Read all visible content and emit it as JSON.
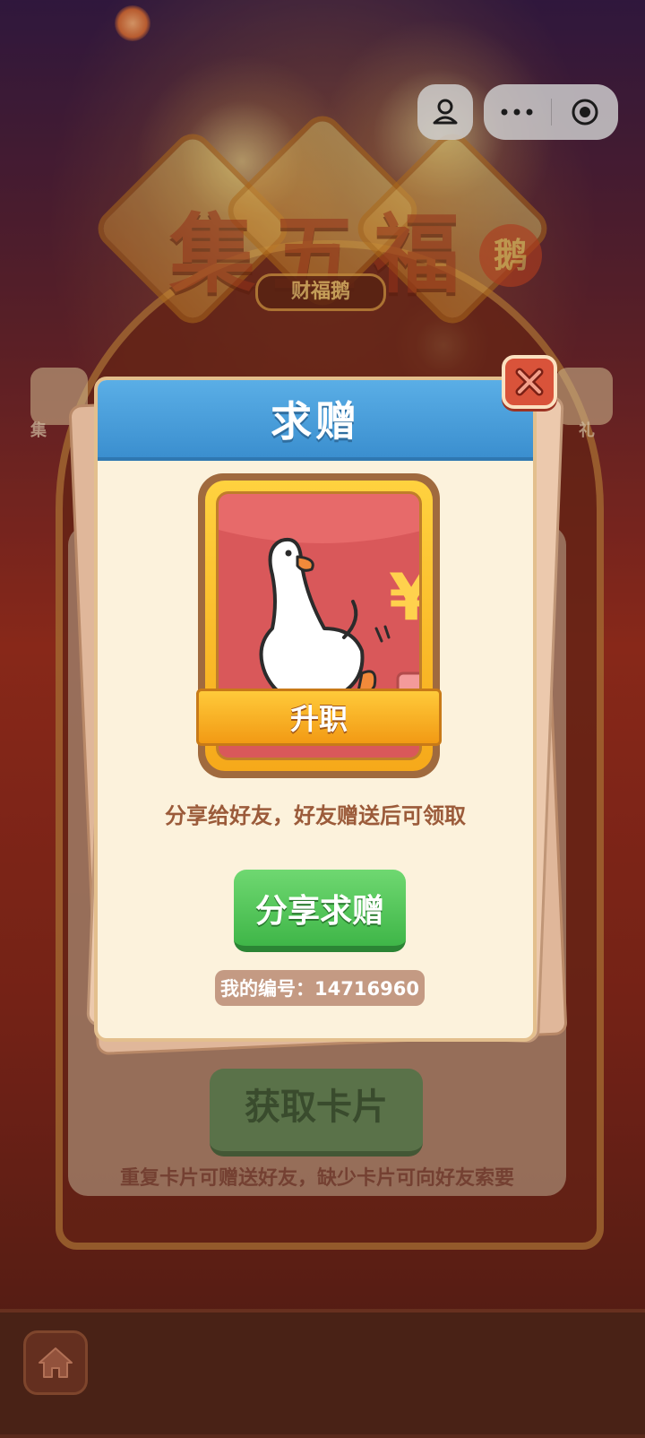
{
  "background": {
    "game_title": "集五福",
    "title_tag": "鹅",
    "subtitle": "财福鹅",
    "get_card_button": "获取卡片",
    "tip": "重复卡片可赠送好友，缺少卡片可向好友索要",
    "side_left_label": "集",
    "side_right_label": "礼"
  },
  "capsule": {
    "user_icon": "user-icon",
    "more_icon": "more-dots-icon",
    "close_icon": "target-close-icon"
  },
  "modal": {
    "title": "求赠",
    "card": {
      "name": "升职",
      "image": "white-goose-on-red-envelope"
    },
    "hint": "分享给好友，好友赠送后可领取",
    "share_button": "分享求赠",
    "my_id": "我的编号：14716960"
  },
  "colors": {
    "header_blue": "#3b8fcf",
    "share_green": "#3fb648",
    "close_red": "#d9533a",
    "modal_bg": "#fcf2dc"
  }
}
